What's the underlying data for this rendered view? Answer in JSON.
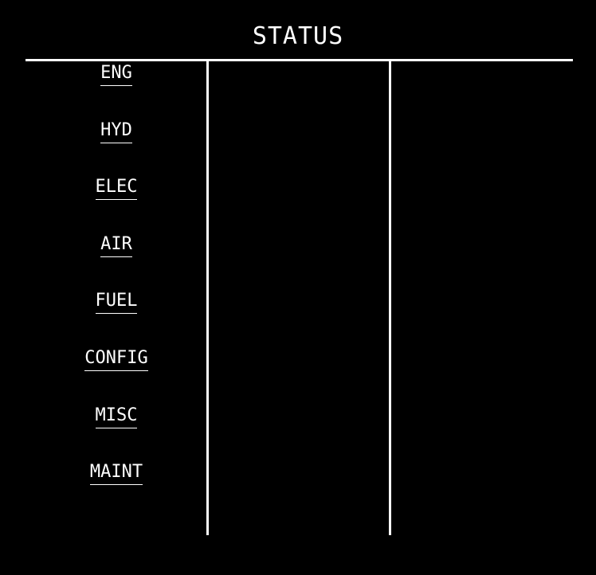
{
  "screen": {
    "title": "STATUS",
    "background_color": "#000000",
    "foreground_color": "#ffffff"
  },
  "menu": {
    "items": [
      {
        "id": "eng",
        "label": "ENG"
      },
      {
        "id": "hyd",
        "label": "HYD"
      },
      {
        "id": "elec",
        "label": "ELEC"
      },
      {
        "id": "air",
        "label": "AIR"
      },
      {
        "id": "fuel",
        "label": "FUEL"
      },
      {
        "id": "config",
        "label": "CONFIG"
      },
      {
        "id": "misc",
        "label": "MISC"
      },
      {
        "id": "maint",
        "label": "MAINT"
      }
    ]
  }
}
